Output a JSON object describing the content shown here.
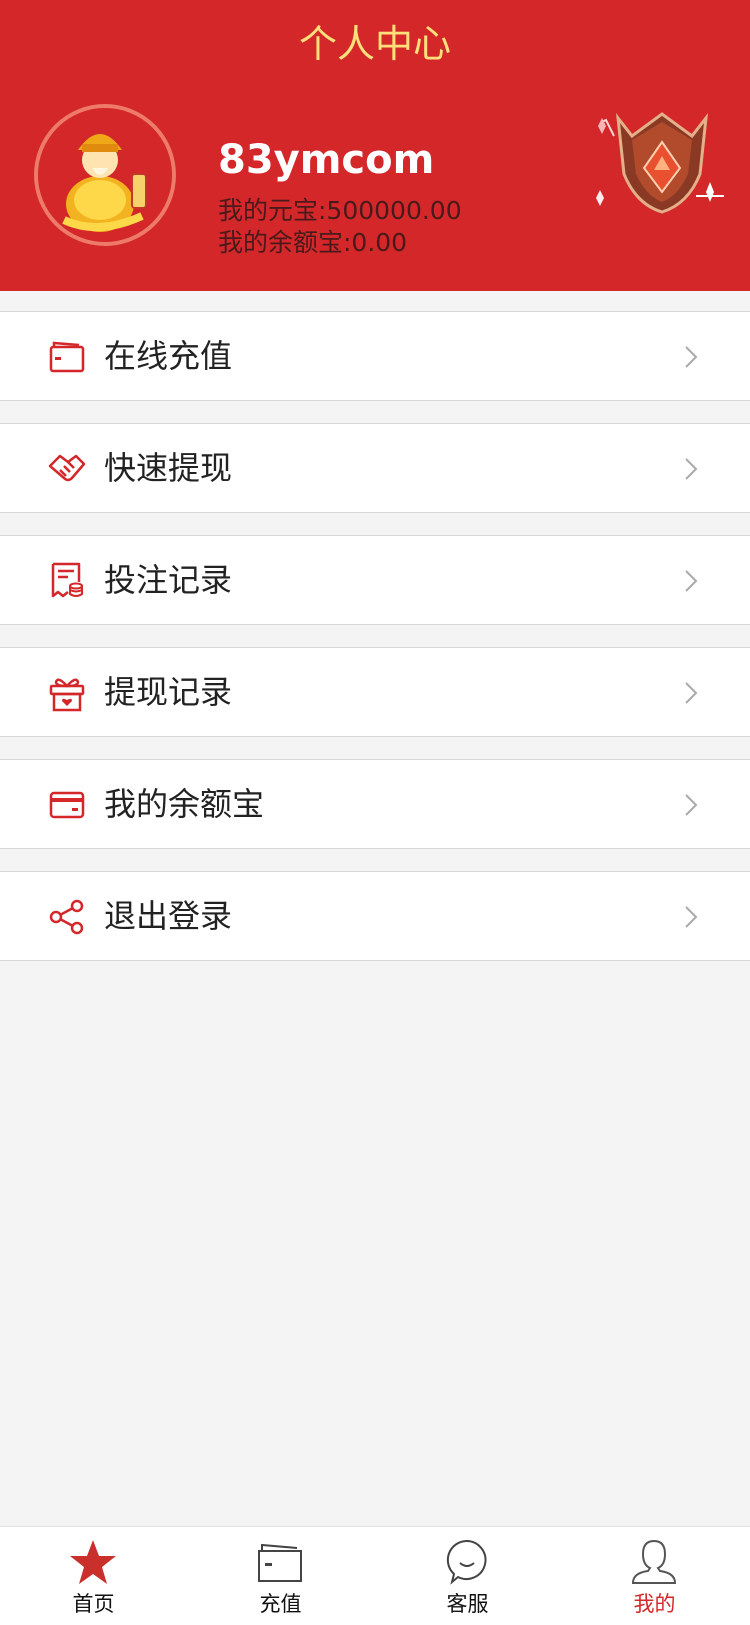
{
  "header": {
    "title": "个人中心",
    "username": "83ymcom",
    "yuanbao_line": "我的元宝:500000.00",
    "balance_line": "我的余额宝:0.00",
    "bg_color": "#d3272a",
    "title_color": "#ffe07a"
  },
  "menu": [
    {
      "label": "在线充值",
      "icon": "wallet-icon"
    },
    {
      "label": "快速提现",
      "icon": "handshake-icon"
    },
    {
      "label": "投注记录",
      "icon": "receipt-icon"
    },
    {
      "label": "提现记录",
      "icon": "gift-icon"
    },
    {
      "label": "我的余额宝",
      "icon": "card-icon"
    },
    {
      "label": "退出登录",
      "icon": "share-icon"
    }
  ],
  "tabbar": {
    "items": [
      {
        "label": "首页",
        "icon": "star-icon"
      },
      {
        "label": "充值",
        "icon": "wallet-icon"
      },
      {
        "label": "客服",
        "icon": "chat-icon"
      },
      {
        "label": "我的",
        "icon": "user-icon"
      }
    ],
    "active": "我的",
    "active_color": "#d3272a"
  }
}
